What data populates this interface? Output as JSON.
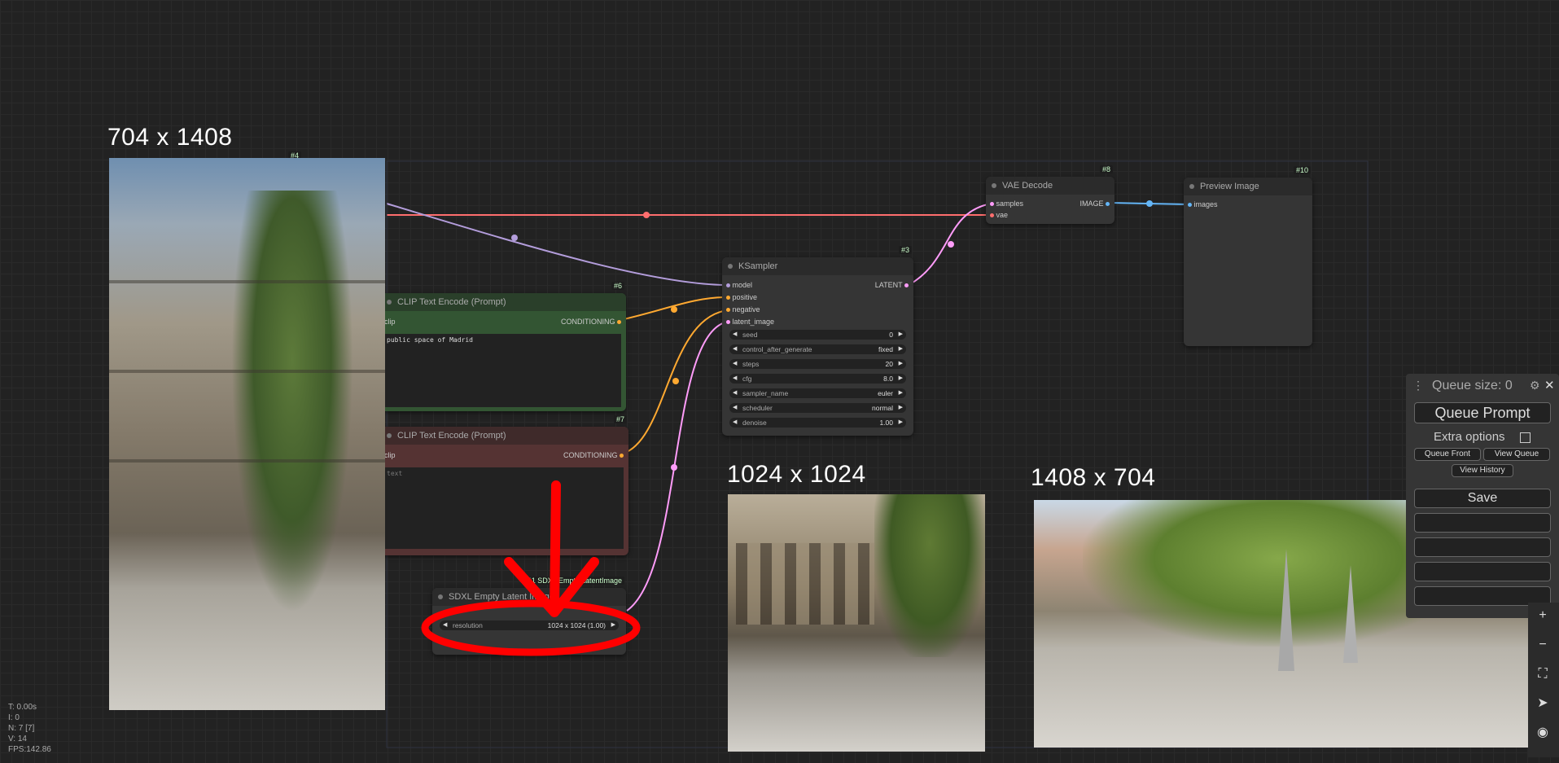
{
  "sizes": {
    "left": "704 x 1408",
    "middle": "1024 x 1024",
    "right": "1408 x 704"
  },
  "nodes": {
    "checkpoint_id": "#4",
    "clip_pos": {
      "id": "#6",
      "title": "CLIP Text Encode (Prompt)",
      "input": "clip",
      "output": "CONDITIONING",
      "text": "public space of Madrid"
    },
    "clip_neg": {
      "id": "#7",
      "title": "CLIP Text Encode (Prompt)",
      "input": "clip",
      "output": "CONDITIONING",
      "text": "text"
    },
    "ksampler": {
      "id": "#3",
      "title": "KSampler",
      "inputs": [
        "model",
        "positive",
        "negative",
        "latent_image"
      ],
      "output": "LATENT",
      "widgets": [
        {
          "label": "seed",
          "value": "0"
        },
        {
          "label": "control_after_generate",
          "value": "fixed"
        },
        {
          "label": "steps",
          "value": "20"
        },
        {
          "label": "cfg",
          "value": "8.0"
        },
        {
          "label": "sampler_name",
          "value": "euler"
        },
        {
          "label": "scheduler",
          "value": "normal"
        },
        {
          "label": "denoise",
          "value": "1.00"
        }
      ]
    },
    "vae": {
      "id": "#8",
      "title": "VAE Decode",
      "inputs": [
        "samples",
        "vae"
      ],
      "output": "IMAGE"
    },
    "preview": {
      "id": "#10",
      "title": "Preview Image",
      "input": "images"
    },
    "latent": {
      "id": "#11 SDXL Empty LatentImage",
      "title": "SDXL Empty Latent Image",
      "widget_label": "resolution",
      "widget_value": "1024 x 1024 (1.00)"
    }
  },
  "queue": {
    "title": "Queue size: 0",
    "queue_prompt": "Queue Prompt",
    "extra_options": "Extra options",
    "queue_front": "Queue Front",
    "view_queue": "View Queue",
    "view_history": "View History",
    "save": "Save"
  },
  "stats": [
    "T: 0.00s",
    "I: 0",
    "N: 7 [7]",
    "V: 14",
    "FPS:142.86"
  ],
  "colors": {
    "model": "#b39ddb",
    "clip": "#ffd500",
    "conditioning": "#ffa931",
    "latent": "#ff9cf9",
    "vae": "#ff6e6e",
    "image": "#64b5f6"
  }
}
